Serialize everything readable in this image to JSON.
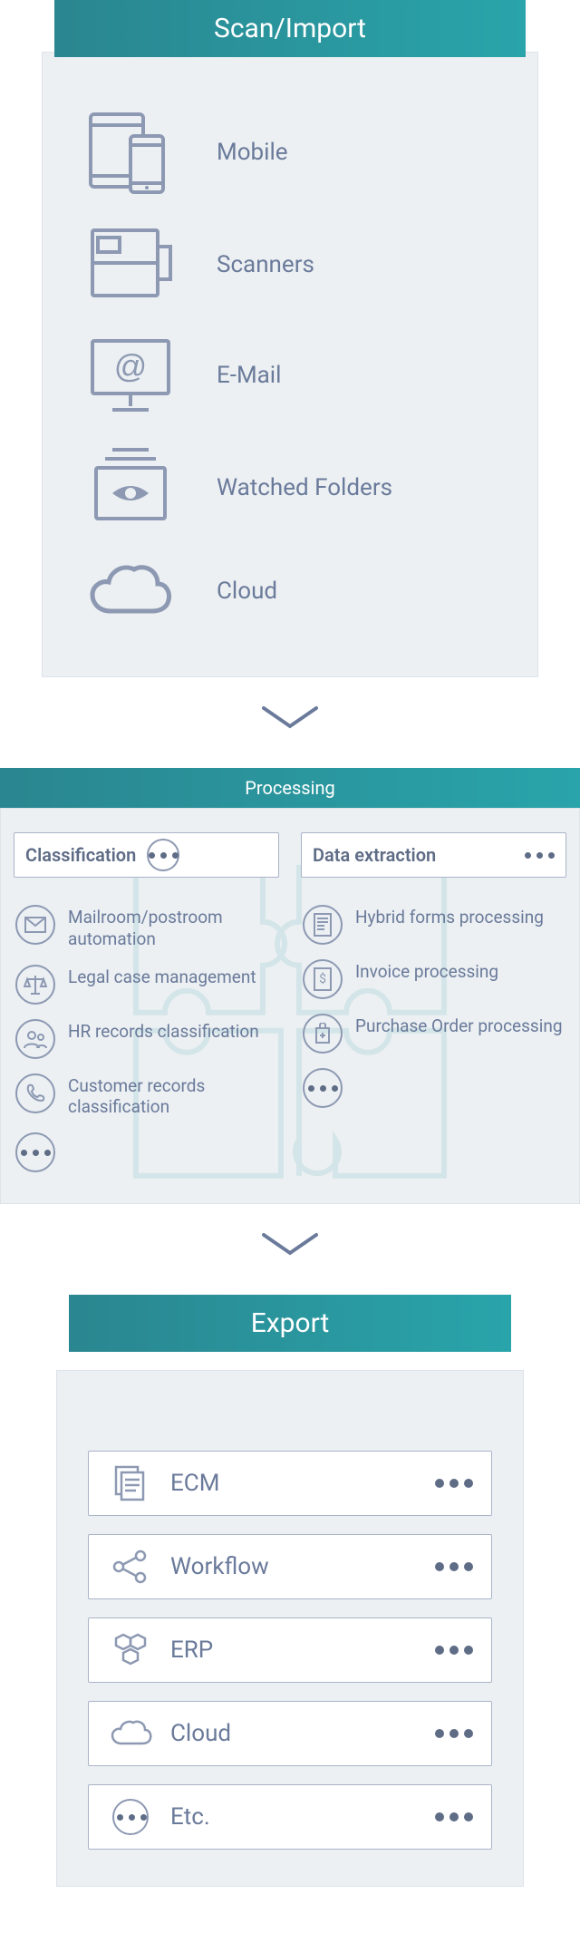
{
  "scan": {
    "title": "Scan/Import",
    "items": [
      {
        "label": "Mobile"
      },
      {
        "label": "Scanners"
      },
      {
        "label": "E-Mail"
      },
      {
        "label": "Watched Folders"
      },
      {
        "label": "Cloud"
      }
    ]
  },
  "processing": {
    "title": "Processing",
    "classification": {
      "title": "Classification",
      "items": [
        "Mailroom/postroom automation",
        "Legal case management",
        "HR records classification",
        "Customer records classification"
      ]
    },
    "extraction": {
      "title": "Data extraction",
      "items": [
        "Hybrid forms processing",
        "Invoice processing",
        "Purchase Order processing"
      ]
    }
  },
  "export": {
    "title": "Export",
    "items": [
      {
        "label": "ECM"
      },
      {
        "label": "Workflow"
      },
      {
        "label": "ERP"
      },
      {
        "label": "Cloud"
      },
      {
        "label": "Etc."
      }
    ]
  }
}
